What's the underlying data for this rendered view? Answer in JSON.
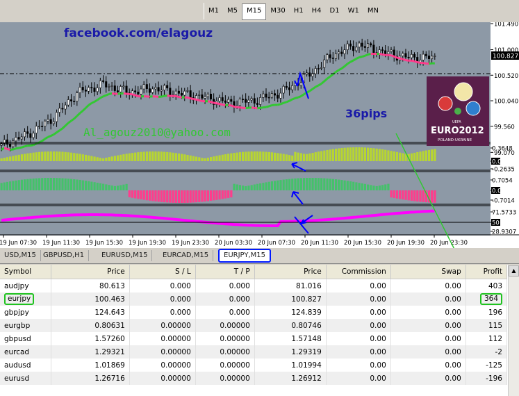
{
  "timeframes": [
    {
      "label": "M1",
      "active": false
    },
    {
      "label": "M5",
      "active": false
    },
    {
      "label": "M15",
      "active": true
    },
    {
      "label": "M30",
      "active": false
    },
    {
      "label": "H1",
      "active": false
    },
    {
      "label": "H4",
      "active": false
    },
    {
      "label": "D1",
      "active": false
    },
    {
      "label": "W1",
      "active": false
    },
    {
      "label": "MN",
      "active": false
    }
  ],
  "chart_data": {
    "type": "line",
    "x": [
      "19 Jun 07:30",
      "19 Jun 11:30",
      "19 Jun 15:30",
      "19 Jun 19:30",
      "19 Jun 23:30",
      "20 Jun 03:30",
      "20 Jun 07:30",
      "20 Jun 11:30",
      "20 Jun 15:30",
      "20 Jun 19:30",
      "20 Jun 23:30"
    ],
    "ylim": [
      99.27,
      101.49
    ],
    "price_ticks": [
      "101.490",
      "101.000",
      "100.827",
      "100.520",
      "100.040",
      "99.560",
      "99.070"
    ],
    "current_price": "100.827",
    "series": [
      {
        "values": [
          99.2,
          99.4,
          99.7,
          100.2,
          100.35,
          100.2,
          100.28,
          100.18,
          100.1,
          100.0,
          100.05,
          100.2,
          100.5,
          100.9,
          101.1,
          100.95,
          100.85,
          100.85
        ]
      }
    ],
    "indicators": [
      {
        "ticks": [
          "0.3648",
          "0.00",
          "-0.2635"
        ]
      },
      {
        "ticks": [
          "0.7054",
          "0.00",
          "-0.7014"
        ]
      },
      {
        "ticks": [
          "71.5733",
          "50",
          "28.9307"
        ]
      }
    ]
  },
  "annotations": {
    "facebook": "facebook.com/elagouz",
    "email": "Al_agouz2010@yahoo.com",
    "pips": "36pips",
    "logo_main": "EURO2012",
    "logo_sub": "POLAND-UKRAINE",
    "logo_uefa": "UEFA"
  },
  "chart_tabs": [
    {
      "label": "USD,M15",
      "active": false
    },
    {
      "label": "GBPUSD,H1",
      "active": false
    },
    {
      "label": "EURUSD,M15",
      "active": false
    },
    {
      "label": "EURCAD,M15",
      "active": false
    },
    {
      "label": "EURJPY,M15",
      "active": true
    }
  ],
  "terminal": {
    "headers": [
      "Symbol",
      "Price",
      "S / L",
      "T / P",
      "Price",
      "Commission",
      "Swap",
      "Profit"
    ],
    "rows": [
      {
        "symbol": "audjpy",
        "open": "80.613",
        "sl": "0.000",
        "tp": "0.000",
        "price": "81.016",
        "commission": "0.00",
        "swap": "0.00",
        "profit": "403"
      },
      {
        "symbol": "eurjpy",
        "open": "100.463",
        "sl": "0.000",
        "tp": "0.000",
        "price": "100.827",
        "commission": "0.00",
        "swap": "0.00",
        "profit": "364"
      },
      {
        "symbol": "gbpjpy",
        "open": "124.643",
        "sl": "0.000",
        "tp": "0.000",
        "price": "124.839",
        "commission": "0.00",
        "swap": "0.00",
        "profit": "196"
      },
      {
        "symbol": "eurgbp",
        "open": "0.80631",
        "sl": "0.00000",
        "tp": "0.00000",
        "price": "0.80746",
        "commission": "0.00",
        "swap": "0.00",
        "profit": "115"
      },
      {
        "symbol": "gbpusd",
        "open": "1.57260",
        "sl": "0.00000",
        "tp": "0.00000",
        "price": "1.57148",
        "commission": "0.00",
        "swap": "0.00",
        "profit": "112"
      },
      {
        "symbol": "eurcad",
        "open": "1.29321",
        "sl": "0.00000",
        "tp": "0.00000",
        "price": "1.29319",
        "commission": "0.00",
        "swap": "0.00",
        "profit": "-2"
      },
      {
        "symbol": "audusd",
        "open": "1.01869",
        "sl": "0.00000",
        "tp": "0.00000",
        "price": "1.01994",
        "commission": "0.00",
        "swap": "0.00",
        "profit": "-125"
      },
      {
        "symbol": "eurusd",
        "open": "1.26716",
        "sl": "0.00000",
        "tp": "0.00000",
        "price": "1.26912",
        "commission": "0.00",
        "swap": "0.00",
        "profit": "-196"
      }
    ]
  },
  "colors": {
    "chart_bg": "#8d99a6",
    "candle": "#000000",
    "ma_up": "#32c832",
    "ma_down": "#ff3c8c",
    "rsi": "#ff00ff",
    "annotation_blue": "#1a1aa8",
    "annotation_green": "#32c832",
    "highlight_green": "#1fc21f",
    "highlight_blue": "#0019ff"
  }
}
